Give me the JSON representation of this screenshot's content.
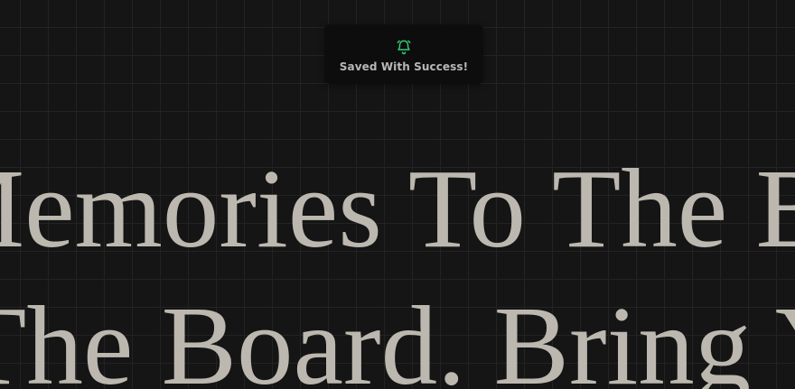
{
  "board": {
    "line1": "Memories To The Board.",
    "line2": "The Board.  Bring Your"
  },
  "toast": {
    "icon": "alarm-bell-icon",
    "message": "Saved With Success!",
    "accent_color": "#2ecc71"
  },
  "colors": {
    "background": "#151515",
    "grid": "#232323",
    "text": "#bcb8b0"
  }
}
